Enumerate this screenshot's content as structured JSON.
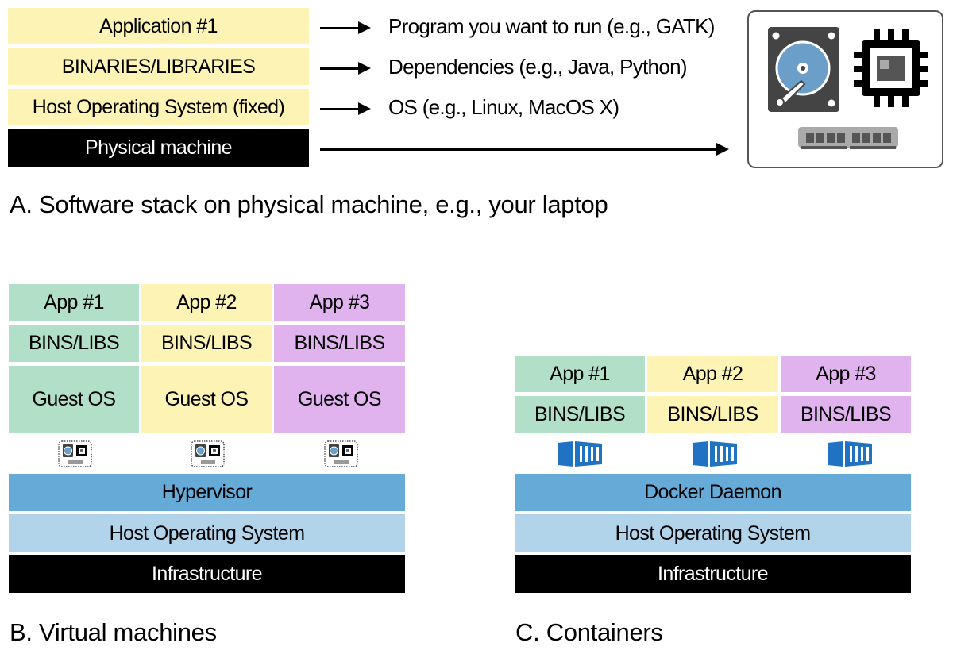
{
  "panel_a": {
    "stack": [
      "Application #1",
      "BINARIES/LIBRARIES",
      "Host Operating System (fixed)",
      "Physical machine"
    ],
    "annotations": [
      "Program you want to run (e.g., GATK)",
      "Dependencies (e.g., Java, Python)",
      "OS (e.g., Linux, MacOS X)"
    ],
    "hardware_icons": [
      "hard-drive-icon",
      "cpu-chip-icon",
      "memory-module-icon"
    ],
    "caption": "A. Software stack on physical machine, e.g., your laptop"
  },
  "panel_b": {
    "columns": [
      {
        "app": "App #1",
        "libs": "BINS/LIBS",
        "os": "Guest OS",
        "color": "#b2dfc8"
      },
      {
        "app": "App #2",
        "libs": "BINS/LIBS",
        "os": "Guest OS",
        "color": "#fdf3b5"
      },
      {
        "app": "App #3",
        "libs": "BINS/LIBS",
        "os": "Guest OS",
        "color": "#e0b3ef"
      }
    ],
    "virtual_hardware_icon": "virtual-hardware-icon",
    "layers": [
      "Hypervisor",
      "Host Operating System",
      "Infrastructure"
    ],
    "caption": "B. Virtual machines"
  },
  "panel_c": {
    "columns": [
      {
        "app": "App #1",
        "libs": "BINS/LIBS",
        "color": "#b2dfc8"
      },
      {
        "app": "App #2",
        "libs": "BINS/LIBS",
        "color": "#fdf3b5"
      },
      {
        "app": "App #3",
        "libs": "BINS/LIBS",
        "color": "#e0b3ef"
      }
    ],
    "container_icon": "shipping-container-icon",
    "layers": [
      "Docker Daemon",
      "Host Operating System",
      "Infrastructure"
    ],
    "caption": "C. Containers"
  },
  "colors": {
    "yellow": "#fdf3b5",
    "green": "#b2dfc8",
    "purple": "#e0b3ef",
    "hypervisor_blue": "#66aad7",
    "host_os_blue": "#b1d4ea",
    "infrastructure": "#000000",
    "container_blue": "#1f73c2",
    "disk_blue": "#6b9ec8"
  }
}
